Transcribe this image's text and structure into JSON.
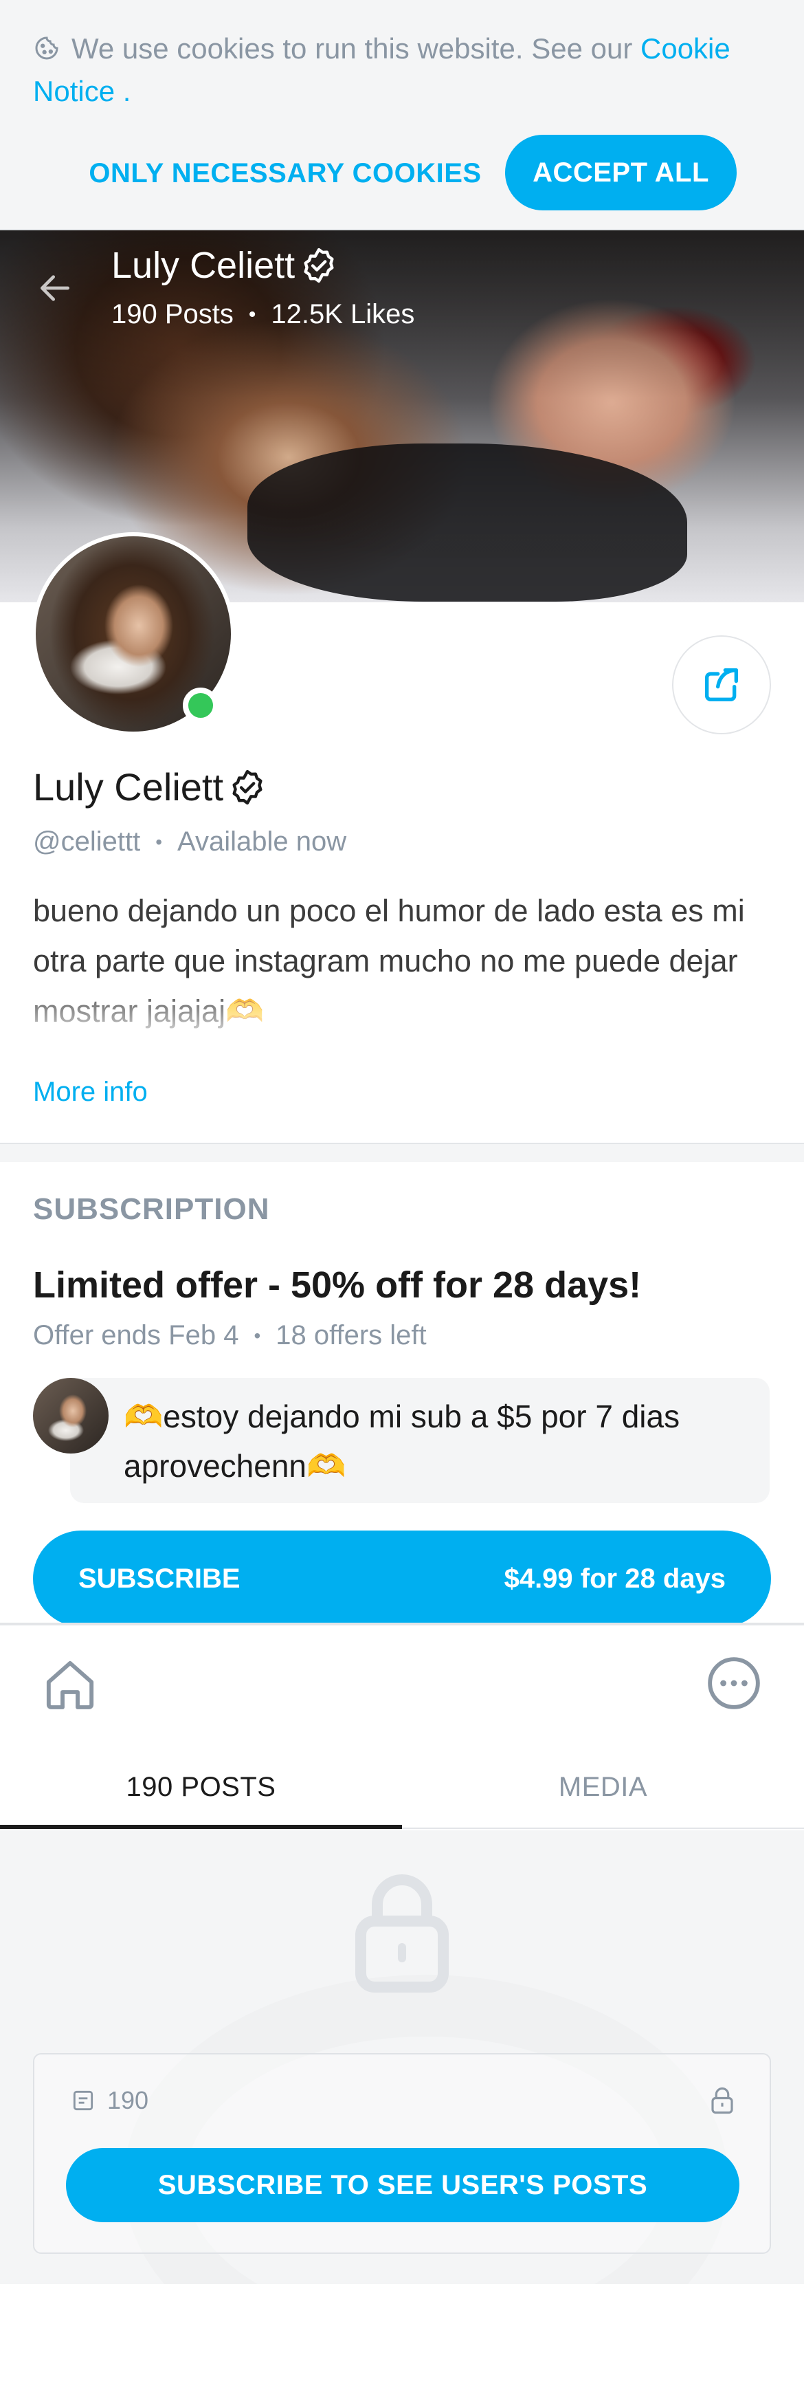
{
  "cookie_banner": {
    "text": "We use cookies to run this website. See our",
    "link": "Cookie Notice",
    "period": ".",
    "necessary_label": "ONLY NECESSARY COOKIES",
    "accept_label": "ACCEPT ALL",
    "icon": "cookie-icon"
  },
  "cover": {
    "name": "Luly Celiett",
    "posts": "190 Posts",
    "likes": "12.5K Likes",
    "separator": "•"
  },
  "profile": {
    "name": "Luly Celiett",
    "handle": "@celiettt",
    "separator": "•",
    "status": "Available now",
    "bio": "bueno dejando un poco el humor de lado esta es mi otra parte que instagram mucho no me puede dejar mostrar jajajaj🫶",
    "more_info": "More info",
    "online": true
  },
  "subscription": {
    "section_title": "SUBSCRIPTION",
    "offer_title": "Limited offer - 50% off for 28 days!",
    "offer_ends": "Offer ends Feb 4",
    "separator": "•",
    "offers_left": "18 offers left",
    "message": "🫶estoy dejando mi sub a $5 por 7 dias aprovechenn🫶",
    "button_label": "SUBSCRIBE",
    "button_price": "$4.99 for 28 days"
  },
  "tabs": [
    {
      "label": "190 POSTS",
      "active": true
    },
    {
      "label": "MEDIA",
      "active": false
    }
  ],
  "locked": {
    "count": "190",
    "button_label": "SUBSCRIBE TO SEE USER'S POSTS"
  },
  "colors": {
    "accent": "#00aff0",
    "muted": "#8a96a3",
    "online": "#34c759"
  }
}
